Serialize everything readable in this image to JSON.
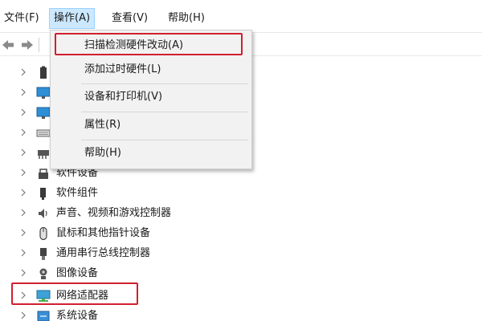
{
  "menubar": {
    "file": "文件(F)",
    "action": "操作(A)",
    "view": "查看(V)",
    "help": "帮助(H)"
  },
  "toolbar": {
    "back_icon": "arrow-left-icon",
    "forward_icon": "arrow-right-icon"
  },
  "dropdown": {
    "items": [
      {
        "label": "扫描检测硬件改动(A)",
        "highlighted": true
      },
      {
        "label": "添加过时硬件(L)"
      },
      {
        "label": "设备和打印机(V)"
      },
      {
        "label": "属性(R)"
      },
      {
        "label": "帮助(H)"
      }
    ]
  },
  "tree": {
    "items": [
      {
        "label": "",
        "icon": "battery-icon"
      },
      {
        "label": "",
        "icon": "monitor-icon"
      },
      {
        "label": "",
        "icon": "monitor-icon"
      },
      {
        "label": "",
        "icon": "keyboard-icon"
      },
      {
        "label": "",
        "icon": "usb-icon"
      },
      {
        "label": "软件设备",
        "icon": "software-device-icon"
      },
      {
        "label": "软件组件",
        "icon": "software-component-icon"
      },
      {
        "label": "声音、视频和游戏控制器",
        "icon": "speaker-icon"
      },
      {
        "label": "鼠标和其他指针设备",
        "icon": "mouse-icon"
      },
      {
        "label": "通用串行总线控制器",
        "icon": "usb-icon"
      },
      {
        "label": "图像设备",
        "icon": "camera-icon"
      },
      {
        "label": "网络适配器",
        "icon": "network-adapter-icon",
        "highlighted": true
      },
      {
        "label": "系统设备",
        "icon": "system-device-icon"
      }
    ]
  },
  "colors": {
    "highlight_border": "#d0202f",
    "menu_active_bg": "#cce8ff",
    "menu_bg": "#f2f2f2"
  }
}
